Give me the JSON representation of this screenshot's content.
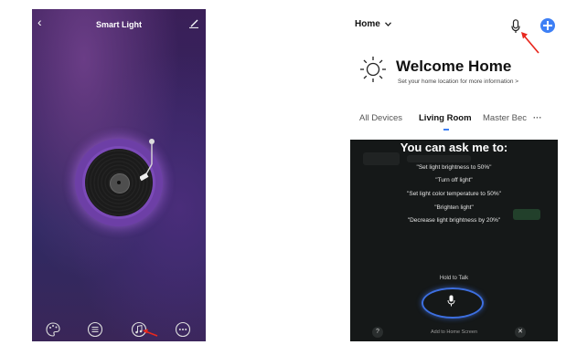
{
  "left_screen": {
    "back_icon": "chevron-left-icon",
    "title": "Smart Light",
    "edit_icon": "pencil-icon",
    "bottom_icons": [
      "palette-icon",
      "list-icon",
      "music-icon",
      "more-icon"
    ],
    "accent": "#7b4ab8"
  },
  "right_screen": {
    "home_selector": "Home",
    "mic_icon": "microphone-icon",
    "add_icon": "plus-icon",
    "welcome_title": "Welcome Home",
    "welcome_subtitle": "Set your home location for more information >",
    "tabs": [
      {
        "label": "All Devices",
        "active": false
      },
      {
        "label": "Living Room",
        "active": true
      },
      {
        "label": "Master Bec",
        "active": false
      }
    ],
    "tabs_more": "···",
    "accent": "#3d7ff5"
  },
  "voice_overlay": {
    "title": "You can ask me to:",
    "suggestions": [
      "\"Set light brightness to 50%\"",
      "\"Turn off light\"",
      "\"Set light color temperature to 50%\"",
      "\"Brighten light\"",
      "\"Decrease light brightness by 20%\""
    ],
    "hold_label": "Hold to Talk",
    "help_label": "?",
    "add_to_home_label": "Add to Home Screen",
    "close_label": "✕"
  }
}
